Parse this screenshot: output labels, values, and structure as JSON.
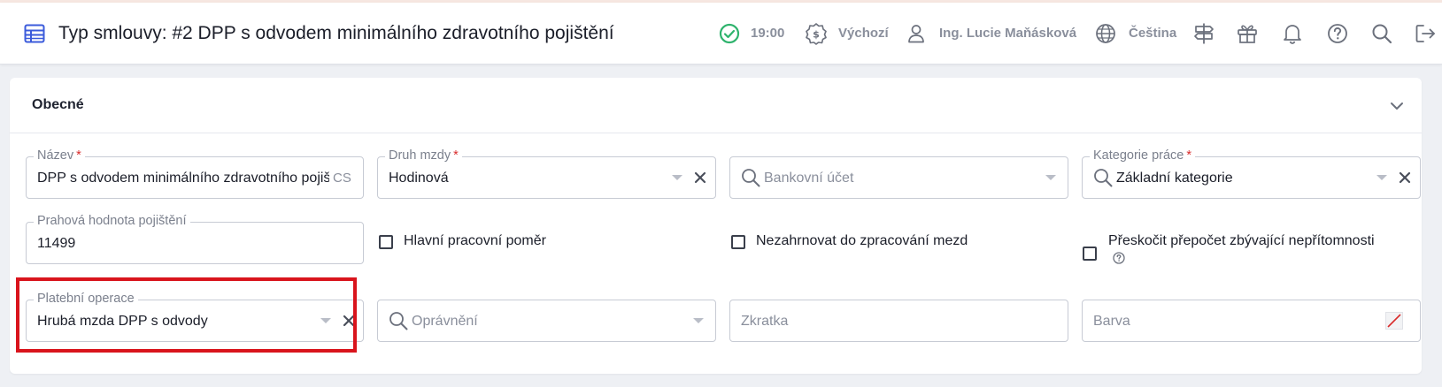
{
  "header": {
    "title": "Typ smlouvy: #2 DPP s odvodem minimálního zdravotního pojištění",
    "time": "19:00",
    "currency_profile": "Výchozí",
    "user_name": "Ing. Lucie Maňásková",
    "language": "Čeština",
    "icons": [
      "table-icon",
      "check-circle-icon",
      "money-icon",
      "user-icon",
      "globe-icon",
      "signpost-icon",
      "gift-icon",
      "bell-icon",
      "help-icon",
      "search-icon",
      "logout-icon"
    ]
  },
  "section": {
    "title": "Obecné",
    "fields": {
      "nazev": {
        "label": "Název",
        "required_mark": "*",
        "value": "DPP s odvodem minimálního zdravotního pojištění",
        "suffix": "CS"
      },
      "druh_mzdy": {
        "label": "Druh mzdy",
        "required_mark": "*",
        "value": "Hodinová"
      },
      "bankovni_ucet": {
        "placeholder": "Bankovní účet"
      },
      "kategorie_prace": {
        "label": "Kategorie práce",
        "required_mark": "*",
        "value": "Základní kategorie"
      },
      "prahova_hodnota": {
        "label": "Prahová hodnota pojištění",
        "value": "11499"
      },
      "platebni_operace": {
        "label": "Platební operace",
        "value": "Hrubá mzda DPP s odvody"
      },
      "opravneni": {
        "placeholder": "Oprávnění"
      },
      "zkratka": {
        "placeholder": "Zkratka"
      },
      "barva": {
        "placeholder": "Barva"
      }
    },
    "checkboxes": {
      "hlavni_pomer": {
        "label": "Hlavní pracovní poměr",
        "checked": false
      },
      "nezahrnovat": {
        "label": "Nezahrnovat do zpracování mezd",
        "checked": false
      },
      "preskocit": {
        "label": "Přeskočit přepočet zbývající nepřítomnosti",
        "checked": false
      }
    }
  },
  "colors": {
    "accent": "#3b5bdb",
    "success": "#2fb36d",
    "highlight": "#d9141c",
    "required": "#d92b2b"
  }
}
